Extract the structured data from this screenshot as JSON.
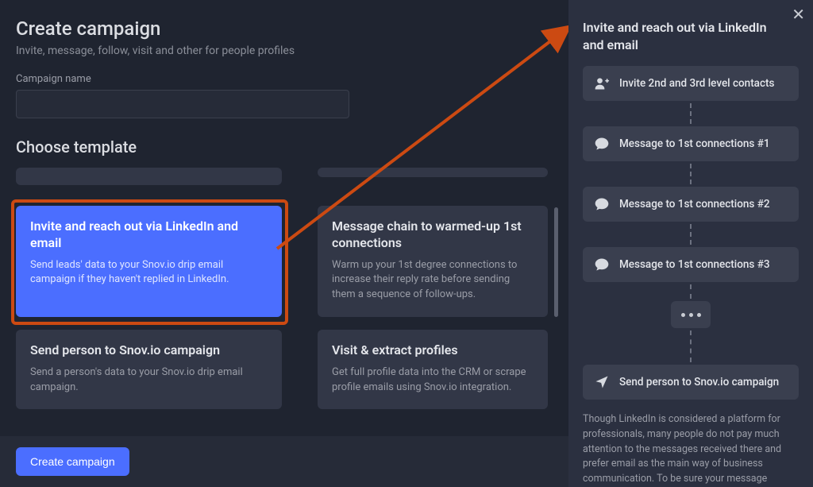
{
  "header": {
    "title": "Create campaign",
    "subtitle": "Invite, message, follow, visit and other for people profiles"
  },
  "campaign_name": {
    "label": "Campaign name",
    "value": ""
  },
  "choose_template_label": "Choose template",
  "templates": {
    "selected": {
      "title": "Invite and reach out via LinkedIn and email",
      "desc": "Send leads' data to your Snov.io drip email campaign if they haven't replied in LinkedIn."
    },
    "b": {
      "title": "Message chain to warmed-up 1st connections",
      "desc": "Warm up your 1st degree connections to increase their reply rate before sending them a sequence of follow-ups."
    },
    "c": {
      "title": "Send person to Snov.io campaign",
      "desc": "Send a person's data to your Snov.io drip email campaign."
    },
    "d": {
      "title": "Visit & extract profiles",
      "desc": "Get full profile data into the CRM or scrape profile emails using Snov.io integration."
    }
  },
  "footer": {
    "create_label": "Create campaign"
  },
  "panel": {
    "title": "Invite and reach out via LinkedIn and email",
    "steps": [
      "Invite 2nd and 3rd level contacts",
      "Message to 1st connections #1",
      "Message to 1st connections #2",
      "Message to 1st connections #3",
      "Send person to Snov.io campaign"
    ],
    "body": "Though LinkedIn is considered a platform for professionals, many people do not pay much attention to the messages received there and prefer email as the main way of business communication. To be sure your message"
  },
  "colors": {
    "accent": "#4b6eff",
    "highlight": "#cc4a12",
    "surface": "#323747",
    "panel": "#2b3040",
    "bg": "#1f2430"
  }
}
